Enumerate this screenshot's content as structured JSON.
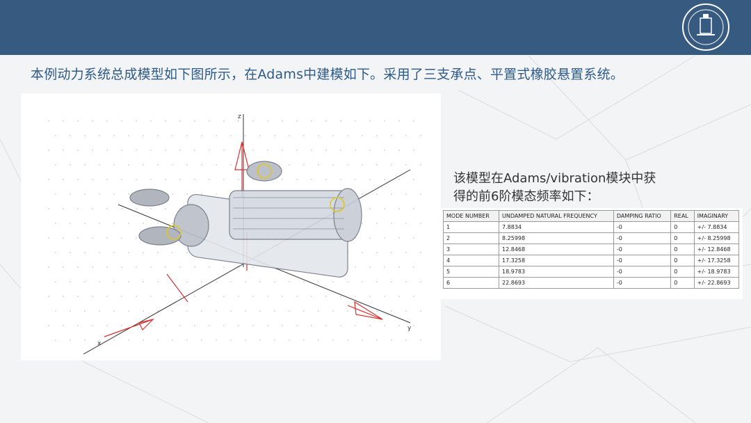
{
  "slide": {
    "intro_text": "本例动力系统总成模型如下图所示，在Adams中建模如下。采用了三支承点、平置式橡胶悬置系统。",
    "caption_line1": "该模型在Adams/vibration模块中获",
    "caption_line2": "得的前6阶模态频率如下：",
    "header_color": "#365a80",
    "text_color": "#2d5a86"
  },
  "model_view": {
    "axis_labels": {
      "z": "z",
      "y": "y",
      "x": "x"
    },
    "icon": "powertrain-3d-model"
  },
  "table": {
    "headers": [
      "MODE NUMBER",
      "UNDAMPED NATURAL FREQUENCY",
      "DAMPING RATIO",
      "REAL",
      "IMAGINARY"
    ],
    "rows": [
      [
        "1",
        "7.8834",
        "-0",
        "0",
        "+/- 7.8834"
      ],
      [
        "2",
        "8.25998",
        "-0",
        "0",
        "+/- 8.25998"
      ],
      [
        "3",
        "12.8468",
        "-0",
        "0",
        "+/- 12.8468"
      ],
      [
        "4",
        "17.3258",
        "-0",
        "0",
        "+/- 17.3258"
      ],
      [
        "5",
        "18.9783",
        "-0",
        "0",
        "+/- 18.9783"
      ],
      [
        "6",
        "22.8693",
        "-0",
        "0",
        "+/- 22.8693"
      ]
    ]
  },
  "logo": {
    "icon": "university-seal-icon"
  }
}
